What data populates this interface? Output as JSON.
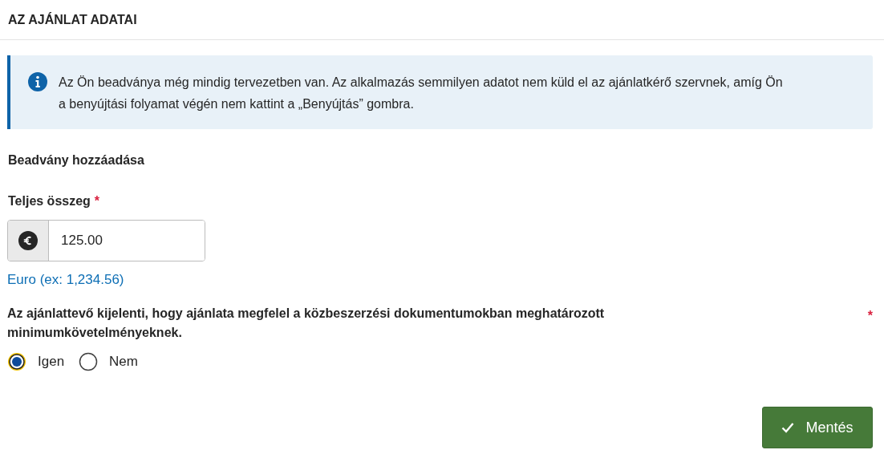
{
  "header": {
    "title": "AZ AJÁNLAT ADATAI"
  },
  "info": {
    "text": "Az Ön beadványa még mindig tervezetben van. Az alkalmazás semmilyen adatot nem küld el az ajánlatkérő szervnek, amíg Ön a benyújtási folyamat végén nem kattint a „Benyújtás” gombra."
  },
  "section_title": "Beadvány hozzáadása",
  "amount": {
    "label": "Teljes összeg",
    "required_mark": "*",
    "value": "125.00",
    "hint": "Euro (ex: 1,234.56)"
  },
  "question": {
    "label": "Az ajánlattevő kijelenti, hogy ajánlata megfelel a közbeszerzési dokumentumokban meghatározott minimumkövetelményeknek.",
    "required_mark": "*",
    "options": [
      {
        "label": "Igen",
        "selected": true
      },
      {
        "label": "Nem",
        "selected": false
      }
    ]
  },
  "buttons": [
    {
      "label": "Mentés"
    }
  ]
}
